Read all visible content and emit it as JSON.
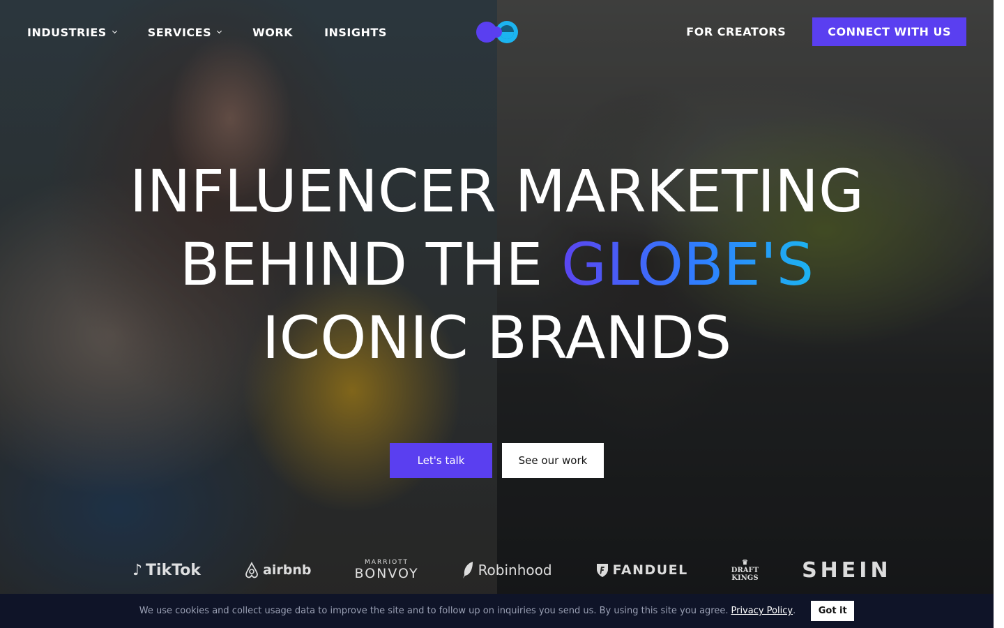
{
  "header": {
    "nav": [
      {
        "label": "INDUSTRIES",
        "has_dropdown": true
      },
      {
        "label": "SERVICES",
        "has_dropdown": true
      },
      {
        "label": "WORK",
        "has_dropdown": false
      },
      {
        "label": "INSIGHTS",
        "has_dropdown": false
      }
    ],
    "logo_icon": "two-circle-smile-logo",
    "for_creators": "FOR CREATORS",
    "connect": "CONNECT WITH US"
  },
  "hero": {
    "line1": "INFLUENCER MARKETING",
    "line2_plain": "BEHIND THE ",
    "line2_highlight": "GLOBE'S",
    "line3": "ICONIC BRANDS",
    "cta_primary": "Let's talk",
    "cta_secondary": "See our work"
  },
  "brands": {
    "tiktok": "TikTok",
    "airbnb": "airbnb",
    "marriott_small": "MARRIOTT",
    "marriott_big": "BONVOY",
    "robinhood": "Robinhood",
    "fanduel": "FANDUEL",
    "draftkings_1": "DRAFT",
    "draftkings_2": "KINGS",
    "shein": "SHEIN"
  },
  "cookie": {
    "text": "We use cookies and collect usage data to improve the site and to follow up on inquiries you send us. By using this site you agree.",
    "link": "Privacy Policy",
    "dot": ".",
    "button": "Got it"
  },
  "colors": {
    "accent": "#5a3ff0",
    "gradient_start": "#5b45f0",
    "gradient_end": "#1cb4f0",
    "cookie_bg": "#0f1428"
  }
}
